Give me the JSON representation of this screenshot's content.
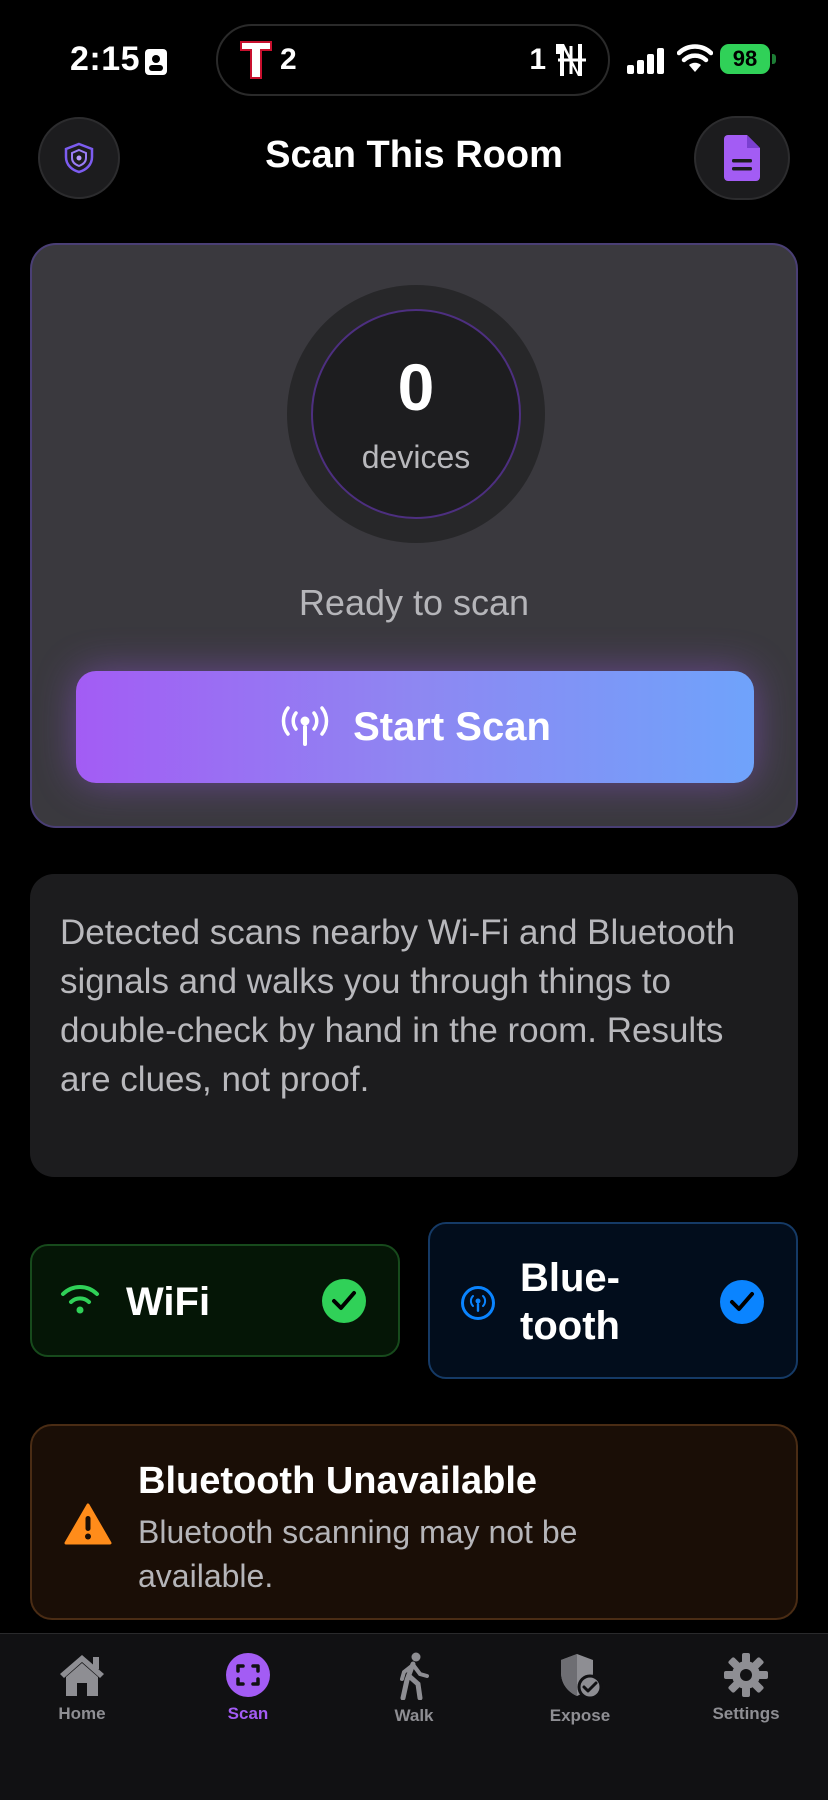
{
  "status_bar": {
    "time": "2:15",
    "score_left": "2",
    "score_right": "1",
    "battery": "98"
  },
  "header": {
    "title": "Scan This Room"
  },
  "scan_card": {
    "device_count": "0",
    "device_label": "devices",
    "status": "Ready to scan",
    "button_label": "Start Scan"
  },
  "info": {
    "text": "Detected scans nearby Wi-Fi and Bluetooth signals and walks you through things to double-check by hand in the room. Results are clues, not proof."
  },
  "radios": {
    "wifi_label": "WiFi",
    "bt_label_line1": "Blue-",
    "bt_label_line2": "tooth"
  },
  "warning": {
    "title": "Bluetooth Unavailable",
    "text": "Bluetooth scanning may not be available."
  },
  "tabs": [
    {
      "label": "Home"
    },
    {
      "label": "Scan"
    },
    {
      "label": "Walk"
    },
    {
      "label": "Expose"
    },
    {
      "label": "Settings"
    }
  ],
  "colors": {
    "accent": "#a35cf4",
    "wifi_green": "#30d158",
    "bt_blue": "#0a84ff",
    "warning_orange": "#ff8c1a"
  }
}
